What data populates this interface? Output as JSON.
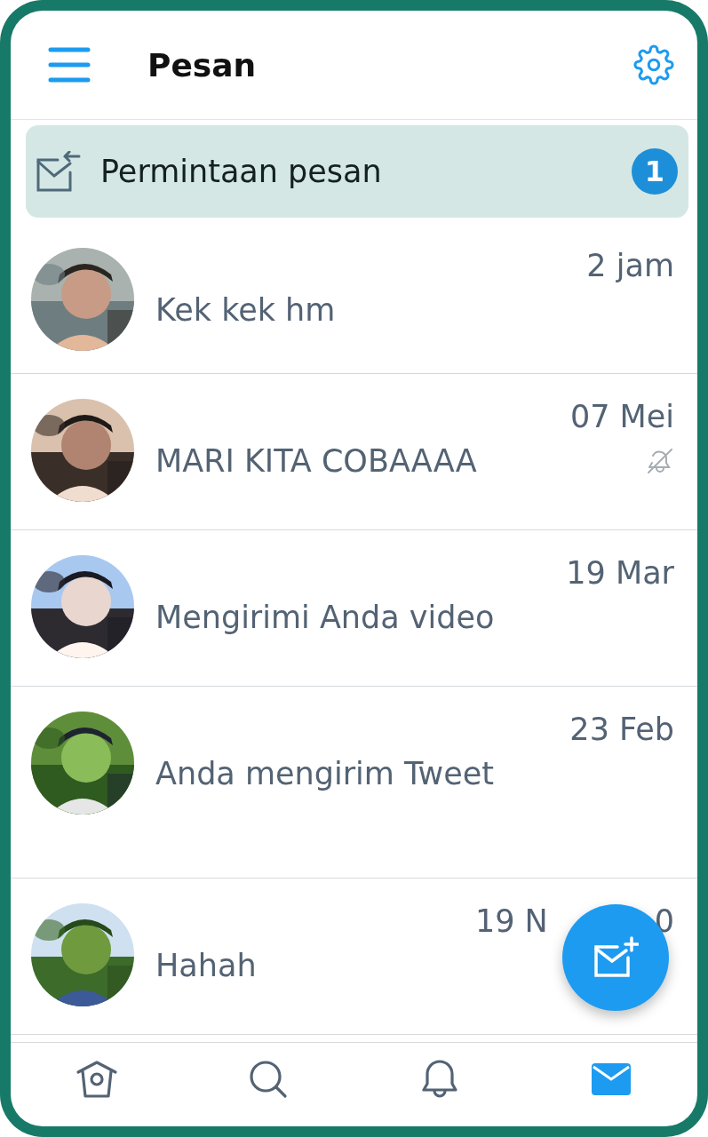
{
  "header": {
    "title": "Pesan"
  },
  "request": {
    "label": "Permintaan pesan",
    "count": "1"
  },
  "conversations": [
    {
      "time_parts": [
        "2 jam"
      ],
      "preview": "Kek kek hm",
      "muted": false
    },
    {
      "time_parts": [
        "07 Mei"
      ],
      "preview": "MARI KITA COBAAAA",
      "muted": true
    },
    {
      "time_parts": [
        "19 Mar"
      ],
      "preview": "Mengirimi Anda video",
      "muted": false
    },
    {
      "time_parts": [
        "23 Feb"
      ],
      "preview": "Anda mengirim Tweet",
      "muted": false
    },
    {
      "time_parts": [
        "19 N",
        "0"
      ],
      "preview": "Hahah",
      "muted": false
    }
  ],
  "nav": [
    {
      "kind": "home",
      "selected": false
    },
    {
      "kind": "search",
      "selected": false
    },
    {
      "kind": "notifications",
      "selected": false
    },
    {
      "kind": "messages",
      "selected": true
    }
  ]
}
